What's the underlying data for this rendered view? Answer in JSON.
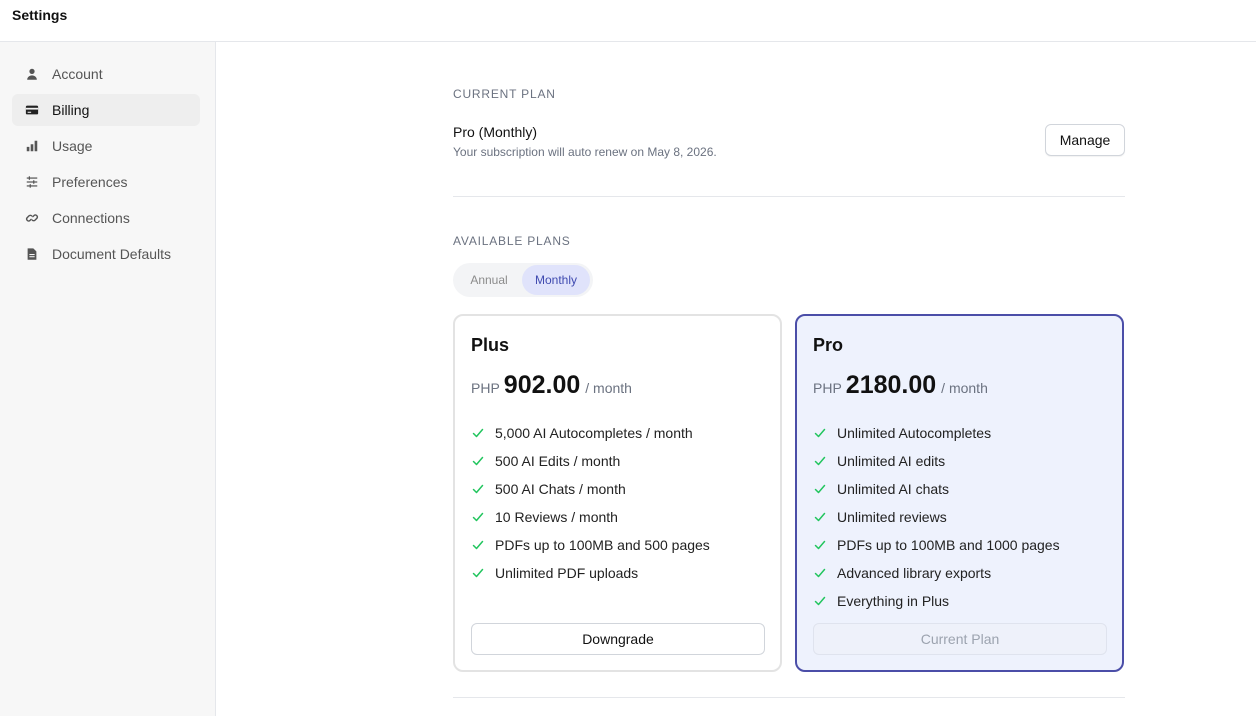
{
  "header": {
    "title": "Settings"
  },
  "sidebar": {
    "items": [
      {
        "label": "Account",
        "icon": "person-icon"
      },
      {
        "label": "Billing",
        "icon": "credit-card-icon",
        "active": true
      },
      {
        "label": "Usage",
        "icon": "bar-chart-icon"
      },
      {
        "label": "Preferences",
        "icon": "sliders-icon"
      },
      {
        "label": "Connections",
        "icon": "link-icon"
      },
      {
        "label": "Document Defaults",
        "icon": "document-icon"
      }
    ]
  },
  "current_plan": {
    "section_label": "CURRENT PLAN",
    "name": "Pro (Monthly)",
    "renewal_text": "Your subscription will auto renew on May 8, 2026.",
    "manage_label": "Manage"
  },
  "available_plans": {
    "section_label": "AVAILABLE PLANS",
    "billing_toggle": {
      "options": [
        "Annual",
        "Monthly"
      ],
      "selected": "Monthly"
    },
    "plans": [
      {
        "name": "Plus",
        "currency": "PHP",
        "price": "902.00",
        "period": "/ month",
        "features": [
          "5,000 AI Autocompletes / month",
          "500 AI Edits / month",
          "500 AI Chats / month",
          "10 Reviews / month",
          "PDFs up to 100MB and 500 pages",
          "Unlimited PDF uploads"
        ],
        "button_label": "Downgrade"
      },
      {
        "name": "Pro",
        "currency": "PHP",
        "price": "2180.00",
        "period": "/ month",
        "features": [
          "Unlimited Autocompletes",
          "Unlimited AI edits",
          "Unlimited AI chats",
          "Unlimited reviews",
          "PDFs up to 100MB and 1000 pages",
          "Advanced library exports",
          "Everything in Plus"
        ],
        "button_label": "Current Plan"
      }
    ]
  },
  "colors": {
    "accent": "#4b4ea8",
    "accent_bg": "#eef2fd",
    "toggle_selected_bg": "#e0e3fb",
    "check": "#22c55e"
  }
}
